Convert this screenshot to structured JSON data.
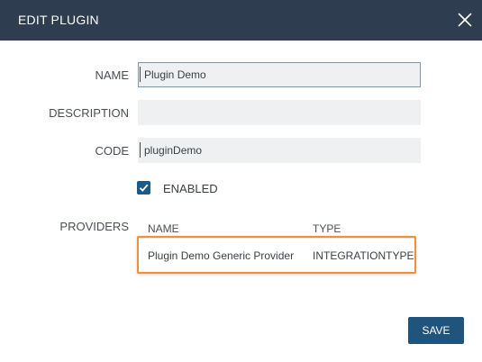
{
  "dialog": {
    "title": "EDIT PLUGIN"
  },
  "form": {
    "name_label": "NAME",
    "name_value": "Plugin Demo",
    "description_label": "DESCRIPTION",
    "description_value": "",
    "code_label": "CODE",
    "code_value": "pluginDemo",
    "enabled_label": "ENABLED",
    "enabled_checked": true,
    "providers_label": "PROVIDERS"
  },
  "providers": {
    "columns": [
      "NAME",
      "TYPE"
    ],
    "rows": [
      {
        "name": "Plugin Demo Generic Provider",
        "type": "INTEGRATIONTYPE"
      }
    ]
  },
  "footer": {
    "save_label": "SAVE"
  },
  "colors": {
    "header_bg": "#2e3d4f",
    "primary_button": "#21547c",
    "highlight_border": "#f0913a"
  },
  "icons": {
    "close": "close-icon",
    "check": "check-icon"
  }
}
